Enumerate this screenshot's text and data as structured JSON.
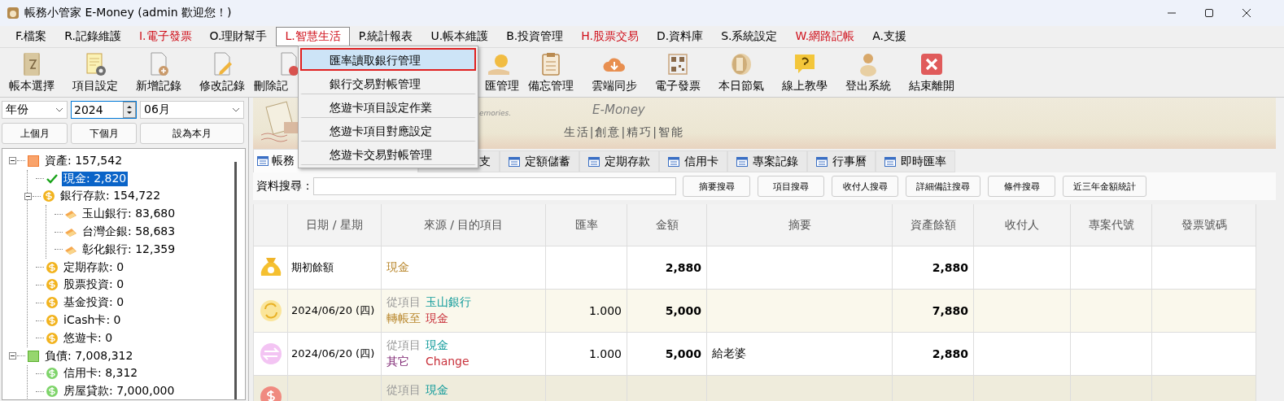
{
  "window": {
    "title": "帳務小管家 E-Money (admin 歡迎您！)"
  },
  "menu_bar": [
    {
      "label": "F.檔案",
      "color": "#000000",
      "selected": false
    },
    {
      "label": "R.記錄維護",
      "color": "#000000",
      "selected": false
    },
    {
      "label": "I.電子發票",
      "color": "#d0101b",
      "selected": false
    },
    {
      "label": "O.理財幫手",
      "color": "#000000",
      "selected": false
    },
    {
      "label": "L.智慧生活",
      "color": "#d0101b",
      "selected": true
    },
    {
      "label": "P.統計報表",
      "color": "#000000",
      "selected": false
    },
    {
      "label": "U.帳本維護",
      "color": "#000000",
      "selected": false
    },
    {
      "label": "B.投資管理",
      "color": "#000000",
      "selected": false
    },
    {
      "label": "H.股票交易",
      "color": "#d0101b",
      "selected": false
    },
    {
      "label": "D.資料庫",
      "color": "#000000",
      "selected": false
    },
    {
      "label": "S.系統設定",
      "color": "#000000",
      "selected": false
    },
    {
      "label": "W.網路記帳",
      "color": "#d0101b",
      "selected": false
    },
    {
      "label": "A.支援",
      "color": "#000000",
      "selected": false
    }
  ],
  "dropdown_menu": [
    {
      "label": "匯率讀取銀行管理",
      "selected": true
    },
    {
      "label": "銀行交易對帳管理",
      "selected": false
    },
    {
      "label": "悠遊卡項目設定作業",
      "selected": false
    },
    {
      "label": "悠遊卡項目對應設定",
      "selected": false
    },
    {
      "label": "悠遊卡交易對帳管理",
      "selected": false
    }
  ],
  "toolbar": [
    "帳本選擇",
    "項目設定",
    "新增記錄",
    "修改記錄",
    "刪除記",
    "匯管理",
    "備忘管理",
    "雲端同步",
    "電子發票",
    "本日節氣",
    "線上教學",
    "登出系統",
    "結束離開"
  ],
  "filters": {
    "period": "年份",
    "year": "2024",
    "month": "06月",
    "buttons": [
      "上個月",
      "下個月",
      "設為本月"
    ]
  },
  "tree": [
    {
      "label": "資產: 157,542",
      "kind": "asset",
      "expanded": true,
      "selected": false,
      "children": [
        {
          "label": "現金: 2,820",
          "kind": "check",
          "selected": true
        },
        {
          "label": "銀行存款: 154,722",
          "kind": "coin",
          "expanded": true,
          "selected": false,
          "children": [
            {
              "label": "玉山銀行: 83,680",
              "kind": "card",
              "selected": false
            },
            {
              "label": "台灣企銀: 58,683",
              "kind": "card",
              "selected": false
            },
            {
              "label": "彰化銀行: 12,359",
              "kind": "card",
              "selected": false
            }
          ]
        },
        {
          "label": "定期存款: 0",
          "kind": "coin",
          "selected": false
        },
        {
          "label": "股票投資: 0",
          "kind": "coin",
          "selected": false
        },
        {
          "label": "基金投資: 0",
          "kind": "coin",
          "selected": false
        },
        {
          "label": "iCash卡: 0",
          "kind": "coin",
          "selected": false
        },
        {
          "label": "悠遊卡: 0",
          "kind": "coin",
          "selected": false
        }
      ]
    },
    {
      "label": "負債: 7,008,312",
      "kind": "liability",
      "expanded": true,
      "selected": false,
      "children": [
        {
          "label": "信用卡: 8,312",
          "kind": "coin-green",
          "selected": false
        },
        {
          "label": "房屋貸款: 7,000,000",
          "kind": "coin-green",
          "selected": false
        }
      ]
    }
  ],
  "banner": {
    "tagline_fragment": "emories.",
    "brand": "E-Money",
    "slogan": "生活|創意|精巧|智能"
  },
  "tabs": [
    {
      "label": "帳務",
      "selected": true
    },
    {
      "label": "支",
      "selected": false
    },
    {
      "label": "定額儲蓄",
      "selected": false
    },
    {
      "label": "定期存款",
      "selected": false
    },
    {
      "label": "信用卡",
      "selected": false
    },
    {
      "label": "專案記錄",
      "selected": false
    },
    {
      "label": "行事曆",
      "selected": false
    },
    {
      "label": "即時匯率",
      "selected": false
    }
  ],
  "search": {
    "label": "資料搜尋：",
    "buttons": [
      "摘要搜尋",
      "項目搜尋",
      "收付人搜尋",
      "詳細備註搜尋",
      "條件搜尋",
      "近三年金額統計"
    ]
  },
  "table": {
    "columns": [
      "日期 / 星期",
      "來源 / 目的項目",
      "匯率",
      "金額",
      "摘要",
      "資產餘額",
      "收付人",
      "專案代號",
      "發票號碼"
    ],
    "rows": [
      {
        "kind": "opening",
        "date": "期初餘額",
        "source": [
          [
            {
              "text": "現金",
              "color": "#b8862b"
            }
          ]
        ],
        "rate": "",
        "amount": "2,880",
        "memo": "",
        "balance": "2,880",
        "payee": "",
        "project": "",
        "invoice": ""
      },
      {
        "kind": "transfer",
        "date": "2024/06/20 (四)",
        "source": [
          [
            {
              "text": "從項目",
              "color": "#999999"
            },
            {
              "text": "玉山銀行",
              "color": "#0f9a9a"
            }
          ],
          [
            {
              "text": "轉帳至",
              "color": "#b8862b"
            },
            {
              "text": "現金",
              "color": "#c8303a"
            }
          ]
        ],
        "rate": "1.000",
        "amount": "5,000",
        "memo": "",
        "balance": "7,880",
        "payee": "",
        "project": "",
        "invoice": ""
      },
      {
        "kind": "exchange",
        "date": "2024/06/20 (四)",
        "source": [
          [
            {
              "text": "從項目",
              "color": "#999999"
            },
            {
              "text": "現金",
              "color": "#0f9a9a"
            }
          ],
          [
            {
              "text": "其它",
              "color": "#7a1f6e"
            },
            {
              "text": "Change",
              "color": "#c8303a"
            }
          ]
        ],
        "rate": "1.000",
        "amount": "5,000",
        "memo": "給老婆",
        "balance": "2,880",
        "payee": "",
        "project": "",
        "invoice": ""
      },
      {
        "kind": "expense",
        "date": "",
        "source": [
          [
            {
              "text": "從項目",
              "color": "#999999"
            },
            {
              "text": "現金",
              "color": "#0f9a9a"
            }
          ]
        ],
        "rate": "",
        "amount": "",
        "memo": "",
        "balance": "",
        "payee": "",
        "project": "",
        "invoice": ""
      }
    ]
  }
}
